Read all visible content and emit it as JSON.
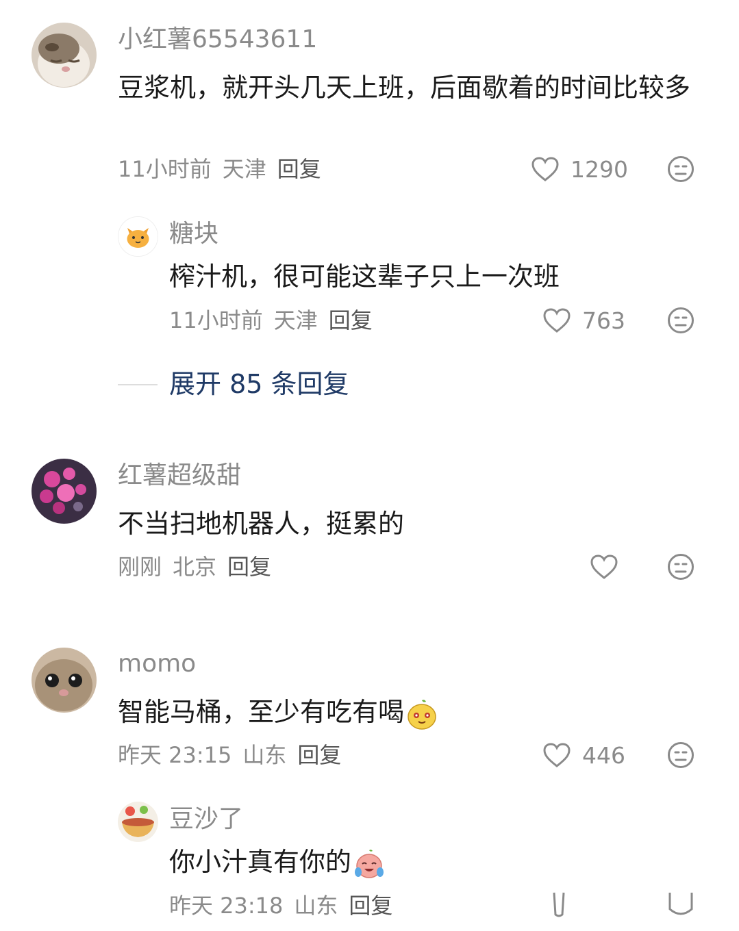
{
  "comments": [
    {
      "user": "小红薯65543611",
      "text": "豆浆机，就开头几天上班，后面歇着的时间比较多",
      "time": "11小时前",
      "location": "天津",
      "reply": "回复",
      "likes": "1290",
      "replies": [
        {
          "user": "糖块",
          "text": "榨汁机，很可能这辈子只上一次班",
          "time": "11小时前",
          "location": "天津",
          "reply": "回复",
          "likes": "763"
        }
      ],
      "expand_label": "展开 85 条回复"
    },
    {
      "user": "红薯超级甜",
      "text": "不当扫地机器人，挺累的",
      "time": "刚刚",
      "location": "北京",
      "reply": "回复",
      "likes": ""
    },
    {
      "user": "momo",
      "text": "智能马桶，至少有吃有喝",
      "time": "昨天 23:15",
      "location": "山东",
      "reply": "回复",
      "likes": "446",
      "replies": [
        {
          "user": "豆沙了",
          "text": "你小汁真有你的",
          "time": "昨天 23:18",
          "location": "山东",
          "reply": "回复",
          "likes": ""
        }
      ]
    }
  ],
  "icons": {
    "like": "heart-outline-icon",
    "dislike": "meh-face-icon"
  },
  "colors": {
    "meta": "#8a8a8a",
    "text": "#1a1a1a",
    "expand": "#1f3a66"
  }
}
